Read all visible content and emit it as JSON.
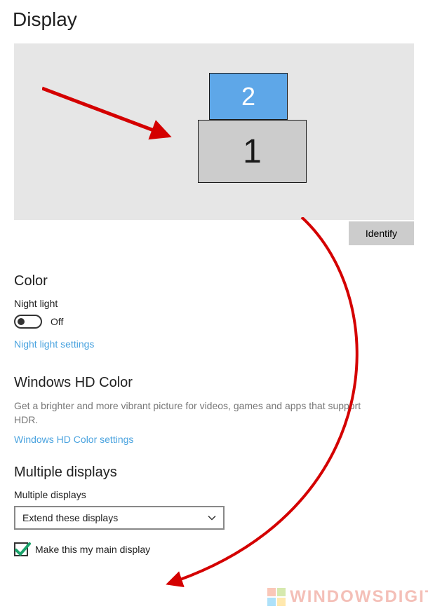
{
  "page": {
    "title": "Display"
  },
  "monitors": {
    "m1_label": "1",
    "m2_label": "2"
  },
  "buttons": {
    "identify": "Identify"
  },
  "color": {
    "heading": "Color",
    "night_light_label": "Night light",
    "night_light_state": "Off",
    "night_light_settings_link": "Night light settings"
  },
  "hd": {
    "heading": "Windows HD Color",
    "desc": "Get a brighter and more vibrant picture for videos, games and apps that support HDR.",
    "link": "Windows HD Color settings"
  },
  "multi": {
    "heading": "Multiple displays",
    "sublabel": "Multiple displays",
    "selected": "Extend these displays",
    "main_checkbox_label": "Make this my main display",
    "main_checkbox_checked": true
  },
  "watermark": {
    "text": "WINDOWSDIGITA"
  },
  "annotation": {
    "arrow_color": "#d40000",
    "checkmark_color": "#1aa36b"
  }
}
